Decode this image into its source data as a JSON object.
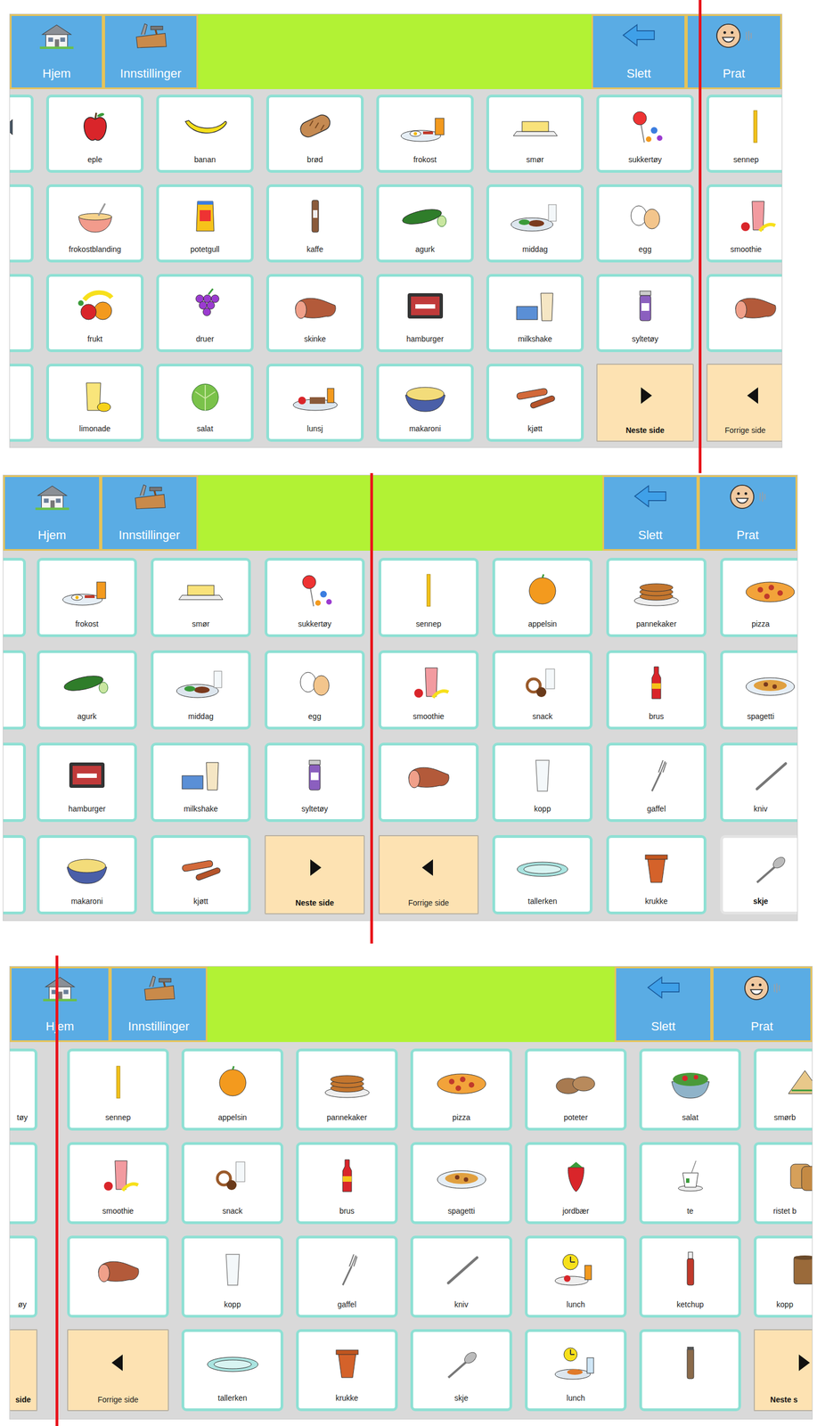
{
  "panels": [
    {
      "toolbar": {
        "home": "Hjem",
        "settings": "Innstillinger",
        "delete": "Slett",
        "speak": "Prat"
      },
      "columns": [
        {
          "cut": "left",
          "cells": [
            {
              "label": "",
              "kind": "fish",
              "highlighted": false
            },
            {
              "label": "",
              "kind": "blank",
              "highlighted": false
            },
            {
              "label": "",
              "kind": "blank",
              "highlighted": false
            },
            {
              "label": "",
              "kind": "blank",
              "highlighted": false
            }
          ]
        },
        {
          "cut": "none",
          "cells": [
            {
              "label": "eple",
              "kind": "apple",
              "highlighted": false
            },
            {
              "label": "frokostblanding",
              "kind": "cereal",
              "highlighted": false
            },
            {
              "label": "frukt",
              "kind": "fruit",
              "highlighted": false
            },
            {
              "label": "limonade",
              "kind": "lemonade",
              "highlighted": false
            }
          ]
        },
        {
          "cut": "none",
          "cells": [
            {
              "label": "banan",
              "kind": "banana",
              "highlighted": false
            },
            {
              "label": "potetgull",
              "kind": "chips",
              "highlighted": false
            },
            {
              "label": "druer",
              "kind": "grapes",
              "highlighted": false
            },
            {
              "label": "salat",
              "kind": "lettuce",
              "highlighted": false
            }
          ]
        },
        {
          "cut": "none",
          "cells": [
            {
              "label": "brød",
              "kind": "bread",
              "highlighted": false
            },
            {
              "label": "kaffe",
              "kind": "coffee",
              "highlighted": false
            },
            {
              "label": "skinke",
              "kind": "ham",
              "highlighted": false
            },
            {
              "label": "lunsj",
              "kind": "lunchplate",
              "highlighted": false
            }
          ]
        },
        {
          "cut": "none",
          "cells": [
            {
              "label": "frokost",
              "kind": "breakfast",
              "highlighted": false
            },
            {
              "label": "agurk",
              "kind": "cucumber",
              "highlighted": false
            },
            {
              "label": "hamburger",
              "kind": "mince",
              "highlighted": false
            },
            {
              "label": "makaroni",
              "kind": "macaroni",
              "highlighted": false
            }
          ]
        },
        {
          "cut": "none",
          "cells": [
            {
              "label": "smør",
              "kind": "butter",
              "highlighted": false
            },
            {
              "label": "middag",
              "kind": "dinner",
              "highlighted": false
            },
            {
              "label": "milkshake",
              "kind": "milkshake",
              "highlighted": false
            },
            {
              "label": "kjøtt",
              "kind": "sausage",
              "highlighted": false
            }
          ]
        },
        {
          "cut": "none",
          "cells": [
            {
              "label": "sukkertøy",
              "kind": "candy",
              "highlighted": false
            },
            {
              "label": "egg",
              "kind": "eggs",
              "highlighted": false
            },
            {
              "label": "syltetøy",
              "kind": "jam",
              "highlighted": false
            },
            {
              "label": "Neste side",
              "kind": "next",
              "highlighted": false
            }
          ]
        },
        {
          "cut": "right",
          "cells": [
            {
              "label": "sennep",
              "kind": "mustard",
              "highlighted": false
            },
            {
              "label": "smoothie",
              "kind": "smoothie",
              "highlighted": false
            },
            {
              "label": "",
              "kind": "ham",
              "highlighted": false
            },
            {
              "label": "Forrige side",
              "kind": "prev",
              "highlighted": false
            }
          ]
        }
      ]
    },
    {
      "toolbar": {
        "home": "Hjem",
        "settings": "Innstillinger",
        "delete": "Slett",
        "speak": "Prat"
      },
      "columns": [
        {
          "cut": "left",
          "cells": [
            {
              "label": "",
              "kind": "blank",
              "highlighted": false
            },
            {
              "label": "",
              "kind": "blank",
              "highlighted": false
            },
            {
              "label": "",
              "kind": "blank",
              "highlighted": false
            },
            {
              "label": "",
              "kind": "blank",
              "highlighted": false
            }
          ]
        },
        {
          "cut": "none",
          "cells": [
            {
              "label": "frokost",
              "kind": "breakfast",
              "highlighted": false
            },
            {
              "label": "agurk",
              "kind": "cucumber",
              "highlighted": false
            },
            {
              "label": "hamburger",
              "kind": "mince",
              "highlighted": false
            },
            {
              "label": "makaroni",
              "kind": "macaroni",
              "highlighted": false
            }
          ]
        },
        {
          "cut": "none",
          "cells": [
            {
              "label": "smør",
              "kind": "butter",
              "highlighted": false
            },
            {
              "label": "middag",
              "kind": "dinner",
              "highlighted": false
            },
            {
              "label": "milkshake",
              "kind": "milkshake",
              "highlighted": false
            },
            {
              "label": "kjøtt",
              "kind": "sausage",
              "highlighted": false
            }
          ]
        },
        {
          "cut": "none",
          "cells": [
            {
              "label": "sukkertøy",
              "kind": "candy",
              "highlighted": false
            },
            {
              "label": "egg",
              "kind": "eggs",
              "highlighted": false
            },
            {
              "label": "syltetøy",
              "kind": "jam",
              "highlighted": false
            },
            {
              "label": "Neste side",
              "kind": "next",
              "highlighted": false
            }
          ]
        },
        {
          "cut": "none",
          "cells": [
            {
              "label": "sennep",
              "kind": "mustard",
              "highlighted": false
            },
            {
              "label": "smoothie",
              "kind": "smoothie",
              "highlighted": false
            },
            {
              "label": "",
              "kind": "ham",
              "highlighted": false
            },
            {
              "label": "Forrige side",
              "kind": "prev",
              "highlighted": false
            }
          ]
        },
        {
          "cut": "none",
          "cells": [
            {
              "label": "appelsin",
              "kind": "orange",
              "highlighted": false
            },
            {
              "label": "snack",
              "kind": "snack",
              "highlighted": false
            },
            {
              "label": "kopp",
              "kind": "glass",
              "highlighted": false
            },
            {
              "label": "tallerken",
              "kind": "plate",
              "highlighted": false
            }
          ]
        },
        {
          "cut": "none",
          "cells": [
            {
              "label": "pannekaker",
              "kind": "pancakes",
              "highlighted": false
            },
            {
              "label": "brus",
              "kind": "soda",
              "highlighted": false
            },
            {
              "label": "gaffel",
              "kind": "fork",
              "highlighted": false
            },
            {
              "label": "krukke",
              "kind": "pot",
              "highlighted": false
            }
          ]
        },
        {
          "cut": "right",
          "cells": [
            {
              "label": "pizza",
              "kind": "pizza",
              "highlighted": false
            },
            {
              "label": "spagetti",
              "kind": "spaghetti",
              "highlighted": false
            },
            {
              "label": "kniv",
              "kind": "knife",
              "highlighted": false
            },
            {
              "label": "skje",
              "kind": "spoon",
              "highlighted": true
            }
          ]
        }
      ]
    },
    {
      "toolbar": {
        "home": "Hjem",
        "settings": "Innstillinger",
        "delete": "Slett",
        "speak": "Prat"
      },
      "columns": [
        {
          "cut": "left",
          "cells": [
            {
              "label": "tøy",
              "kind": "candy",
              "highlighted": false
            },
            {
              "label": "",
              "kind": "eggs",
              "highlighted": false
            },
            {
              "label": "øy",
              "kind": "jam",
              "highlighted": false
            },
            {
              "label": "side",
              "kind": "next",
              "highlighted": false
            }
          ]
        },
        {
          "cut": "none",
          "cells": [
            {
              "label": "sennep",
              "kind": "mustard",
              "highlighted": false
            },
            {
              "label": "smoothie",
              "kind": "smoothie",
              "highlighted": false
            },
            {
              "label": "",
              "kind": "ham",
              "highlighted": false
            },
            {
              "label": "Forrige side",
              "kind": "prev",
              "highlighted": false
            }
          ]
        },
        {
          "cut": "none",
          "cells": [
            {
              "label": "appelsin",
              "kind": "orange",
              "highlighted": false
            },
            {
              "label": "snack",
              "kind": "snack",
              "highlighted": false
            },
            {
              "label": "kopp",
              "kind": "glass",
              "highlighted": false
            },
            {
              "label": "tallerken",
              "kind": "plate",
              "highlighted": false
            }
          ]
        },
        {
          "cut": "none",
          "cells": [
            {
              "label": "pannekaker",
              "kind": "pancakes",
              "highlighted": false
            },
            {
              "label": "brus",
              "kind": "soda",
              "highlighted": false
            },
            {
              "label": "gaffel",
              "kind": "fork",
              "highlighted": false
            },
            {
              "label": "krukke",
              "kind": "pot",
              "highlighted": false
            }
          ]
        },
        {
          "cut": "none",
          "cells": [
            {
              "label": "pizza",
              "kind": "pizza",
              "highlighted": false
            },
            {
              "label": "spagetti",
              "kind": "spaghetti",
              "highlighted": false
            },
            {
              "label": "kniv",
              "kind": "knife",
              "highlighted": false
            },
            {
              "label": "skje",
              "kind": "spoon",
              "highlighted": false
            }
          ]
        },
        {
          "cut": "none",
          "cells": [
            {
              "label": "poteter",
              "kind": "potatoes",
              "highlighted": false
            },
            {
              "label": "jordbær",
              "kind": "strawberry",
              "highlighted": false
            },
            {
              "label": "lunch",
              "kind": "lunchclock",
              "highlighted": false
            },
            {
              "label": "lunch",
              "kind": "lunchdinner",
              "highlighted": false
            }
          ]
        },
        {
          "cut": "none",
          "cells": [
            {
              "label": "salat",
              "kind": "salad",
              "highlighted": false
            },
            {
              "label": "te",
              "kind": "tea",
              "highlighted": false
            },
            {
              "label": "ketchup",
              "kind": "ketchup",
              "highlighted": false
            },
            {
              "label": "",
              "kind": "spice",
              "highlighted": false
            }
          ]
        },
        {
          "cut": "right",
          "cells": [
            {
              "label": "smørb",
              "kind": "sandwich",
              "highlighted": false
            },
            {
              "label": "ristet b",
              "kind": "toast",
              "highlighted": false
            },
            {
              "label": "kopp",
              "kind": "mug",
              "highlighted": false
            },
            {
              "label": "Neste s",
              "kind": "next",
              "highlighted": false
            }
          ]
        }
      ]
    }
  ]
}
